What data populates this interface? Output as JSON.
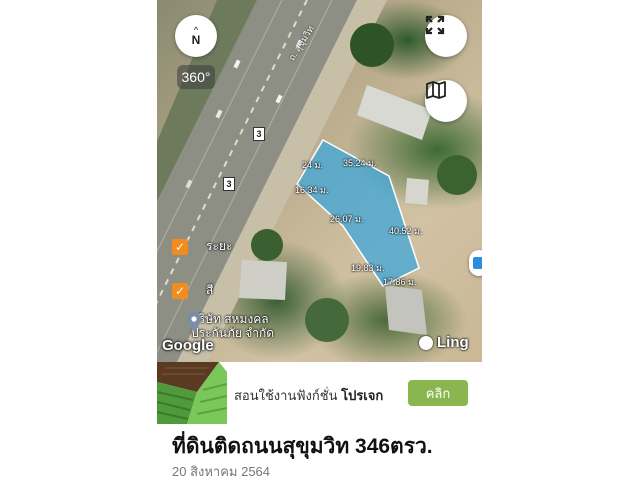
{
  "map": {
    "compass": {
      "arrow": "^",
      "letter": "N"
    },
    "view_360_label": "360°",
    "road_label": "ถ. สุขุมวิท",
    "route_badges": [
      "3",
      "3"
    ],
    "measurements": [
      "24 ม.",
      "35.24 ม.",
      "16.34 ม.",
      "26.07 ม.",
      "40.52 ม.",
      "19.83 ม.",
      "17.86 ม."
    ],
    "legend": [
      {
        "label": "ระยะ",
        "checked": true
      },
      {
        "label": "สี",
        "checked": true
      }
    ],
    "place": {
      "line1": "บริษัท สหมงคล",
      "line2": "ประกันภัย จำกัด"
    },
    "google_logo": "Google",
    "ling_logo": "Ling",
    "icons": {
      "expand": "expand-icon",
      "map_layer": "map-layer-icon",
      "pin": "location-pin-icon"
    },
    "colors": {
      "plot_fill": "#3fa7d9",
      "checkbox": "#f28c1e"
    }
  },
  "banner": {
    "text_prefix": "สอนใช้งานฟังก์ชั่น",
    "text_bold": "โปรเจก",
    "button_label": "คลิก",
    "colors": {
      "button": "#8ab650"
    }
  },
  "listing": {
    "title": "ที่ดินติดถนนสุขุมวิท 346ตรว.",
    "date": "20 สิงหาคม 2564"
  }
}
